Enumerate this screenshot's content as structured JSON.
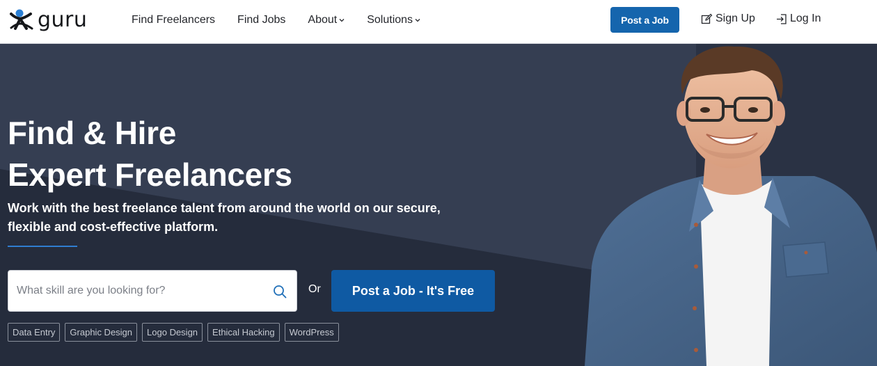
{
  "brand": {
    "name": "guru",
    "accent_color": "#1565ad",
    "logo_icon": "guru-person-icon"
  },
  "nav": {
    "items": [
      {
        "label": "Find Freelancers",
        "has_dropdown": false
      },
      {
        "label": "Find Jobs",
        "has_dropdown": false
      },
      {
        "label": "About",
        "has_dropdown": true
      },
      {
        "label": "Solutions",
        "has_dropdown": true
      }
    ],
    "post_job_label": "Post a Job",
    "sign_up_label": "Sign Up",
    "sign_up_icon": "edit-icon",
    "log_in_label": "Log In",
    "log_in_icon": "login-icon"
  },
  "hero": {
    "headline_line1": "Find & Hire",
    "headline_line2": "Expert Freelancers",
    "subheadline": "Work with the best freelance talent from around the world on our secure, flexible and cost-effective platform.",
    "search_placeholder": "What skill are you looking for?",
    "search_icon": "search-icon",
    "or_label": "Or",
    "cta_label": "Post a Job - It's Free",
    "background_color": "#2c3447",
    "tags": [
      "Data Entry",
      "Graphic Design",
      "Logo Design",
      "Ethical Hacking",
      "WordPress"
    ]
  }
}
